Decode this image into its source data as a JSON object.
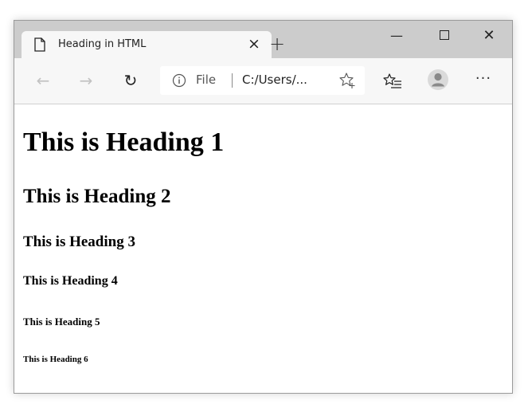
{
  "browser": {
    "tab": {
      "title": "Heading in HTML",
      "close_glyph": "×",
      "icon": "page-icon"
    },
    "new_tab_glyph": "+",
    "window_controls": {
      "minimize_glyph": "—",
      "close_glyph": "✕"
    },
    "toolbar": {
      "back_glyph": "←",
      "forward_glyph": "→",
      "refresh_glyph": "↻",
      "address": {
        "scheme_label": "File",
        "url": "C:/Users/..."
      },
      "menu_glyph": "···"
    }
  },
  "page": {
    "headings": [
      "This is Heading 1",
      "This is Heading 2",
      "This is Heading 3",
      "This is Heading 4",
      "This is Heading 5",
      "This is Heading 6"
    ]
  },
  "colors": {
    "titlebar": "#cccccc",
    "toolbar": "#f7f7f7",
    "tab_active": "#f7f7f7",
    "disabled_nav": "#c2c2c2",
    "text": "#000000"
  }
}
